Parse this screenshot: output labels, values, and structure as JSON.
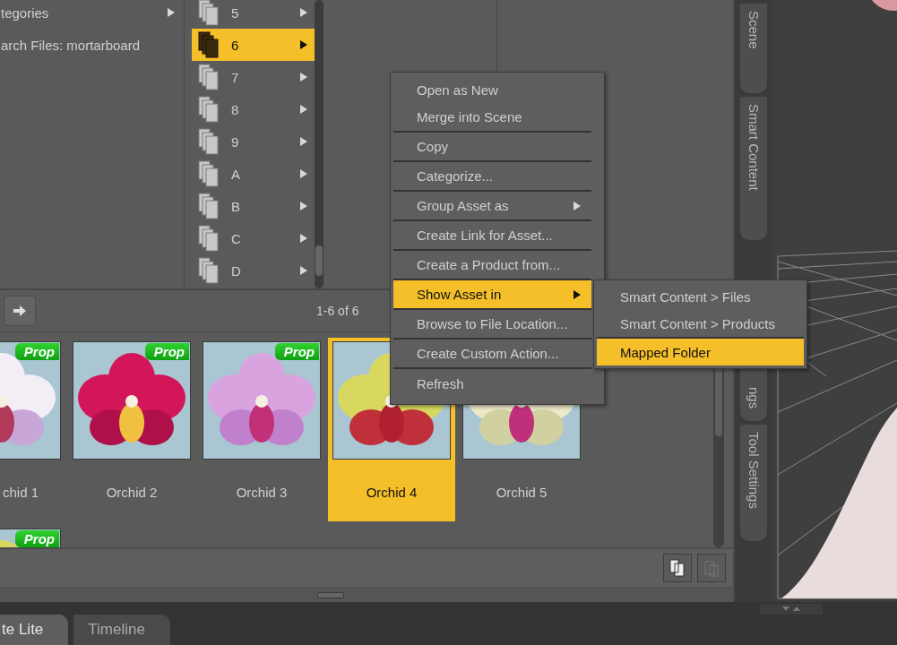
{
  "category_list": {
    "items": [
      {
        "label": "tegories",
        "submenu": true
      },
      {
        "label": "arch Files: mortarboard",
        "submenu": false
      }
    ]
  },
  "folder_list": {
    "items": [
      {
        "label": "5",
        "selected": false
      },
      {
        "label": "6",
        "selected": true
      },
      {
        "label": "7",
        "selected": false
      },
      {
        "label": "8",
        "selected": false
      },
      {
        "label": "9",
        "selected": false
      },
      {
        "label": "A",
        "selected": false
      },
      {
        "label": "B",
        "selected": false
      },
      {
        "label": "C",
        "selected": false
      },
      {
        "label": "D",
        "selected": false
      }
    ]
  },
  "results": {
    "count": "1-6 of 6",
    "items": [
      {
        "label": "chid 1",
        "badge": "Prop",
        "selected": false
      },
      {
        "label": "Orchid 2",
        "badge": "Prop",
        "selected": false
      },
      {
        "label": "Orchid 3",
        "badge": "Prop",
        "selected": false
      },
      {
        "label": "Orchid 4",
        "selected": true
      },
      {
        "label": "Orchid 5",
        "selected": false
      },
      {
        "badge": "Prop",
        "selected": false
      }
    ]
  },
  "context_menu": {
    "items": [
      {
        "label": "Open as New",
        "selected": false,
        "submenu": false,
        "separator_after": false
      },
      {
        "label": "Merge into Scene",
        "selected": false,
        "submenu": false,
        "separator_after": true
      },
      {
        "label": "Copy",
        "selected": false,
        "submenu": false,
        "separator_after": true
      },
      {
        "label": "Categorize...",
        "selected": false,
        "submenu": false,
        "separator_after": true
      },
      {
        "label": "Group Asset as",
        "selected": false,
        "submenu": true,
        "separator_after": true
      },
      {
        "label": "Create Link for Asset...",
        "selected": false,
        "submenu": false,
        "separator_after": true
      },
      {
        "label": "Create a Product from...",
        "selected": false,
        "submenu": false,
        "separator_after": true
      },
      {
        "label": "Show Asset in",
        "selected": true,
        "submenu": true,
        "separator_after": true
      },
      {
        "label": "Browse to File Location...",
        "selected": false,
        "submenu": false,
        "separator_after": true
      },
      {
        "label": "Create Custom Action...",
        "selected": false,
        "submenu": false,
        "separator_after": true
      },
      {
        "label": "Refresh",
        "selected": false,
        "submenu": false,
        "separator_after": false
      }
    ]
  },
  "submenu": {
    "items": [
      {
        "label": "Smart Content > Files",
        "selected": false,
        "separator_after": false
      },
      {
        "label": "Smart Content > Products",
        "selected": false,
        "separator_after": true
      },
      {
        "label": "Mapped Folder",
        "selected": true,
        "separator_after": false
      }
    ]
  },
  "side_tabs": [
    {
      "label": "Scene"
    },
    {
      "label": "Smart Content"
    },
    {
      "label": "ngs"
    },
    {
      "label": "Tool Settings"
    }
  ],
  "bottom_tabs": [
    {
      "label": "te Lite",
      "selected": true
    },
    {
      "label": "Timeline",
      "selected": false
    }
  ]
}
